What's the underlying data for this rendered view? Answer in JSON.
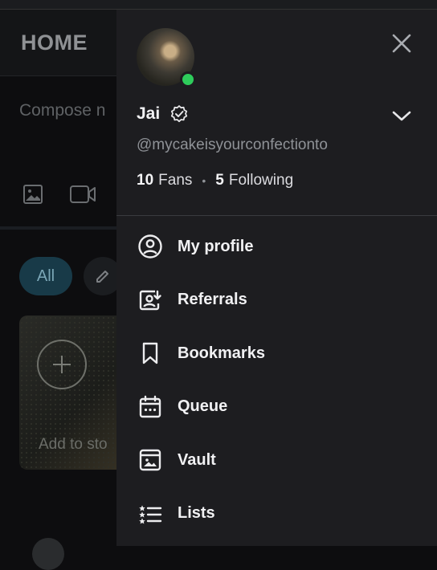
{
  "background": {
    "header_title": "HOME",
    "compose_placeholder": "Compose n",
    "filter_all": "All",
    "story_label": "Add to sto"
  },
  "profile": {
    "name": "Jai",
    "handle": "@mycakeisyourconfectionto",
    "fans_count": "10",
    "fans_label": "Fans",
    "following_count": "5",
    "following_label": "Following",
    "separator": "•",
    "online_color": "#2ecc5b",
    "verified": true
  },
  "menu": [
    {
      "label": "My profile",
      "icon": "profile-circle-icon"
    },
    {
      "label": "Referrals",
      "icon": "referrals-icon"
    },
    {
      "label": "Bookmarks",
      "icon": "bookmark-icon"
    },
    {
      "label": "Queue",
      "icon": "calendar-queue-icon"
    },
    {
      "label": "Vault",
      "icon": "vault-icon"
    },
    {
      "label": "Lists",
      "icon": "lists-icon"
    }
  ]
}
